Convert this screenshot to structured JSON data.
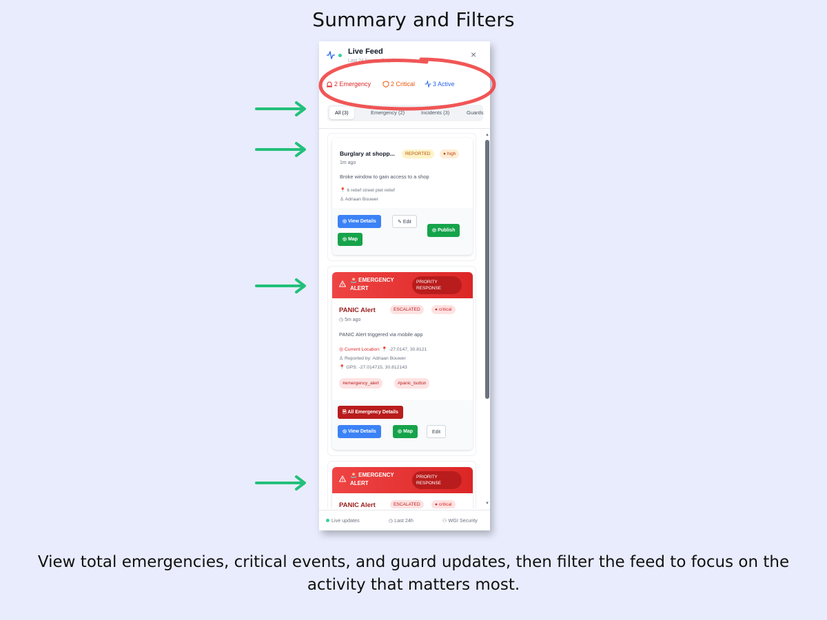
{
  "page": {
    "heading": "Summary and Filters",
    "caption": "View total emergencies, critical events, and guard updates, then filter the feed to focus on the activity that matters most."
  },
  "panel": {
    "title": "Live Feed",
    "subtitle": "Last 24 hours • 3 updates",
    "close_icon": "×",
    "stats": {
      "emergency": "2 Emergency",
      "critical": "2 Critical",
      "active": "3 Active"
    },
    "tabs": [
      {
        "label": "All (3)",
        "active": true
      },
      {
        "label": "Emergency (2)",
        "active": false
      },
      {
        "label": "Incidents (3)",
        "active": false
      },
      {
        "label": "Guards",
        "active": false
      }
    ],
    "incident": {
      "title": "Burglary at shopp...",
      "status": "REPORTED",
      "severity": "high",
      "time": "1m ago",
      "description": "Broke window to gain access to a shop",
      "address": "6 retief street piet retief",
      "reporter": "Adriaan Bouwer",
      "buttons": {
        "view": "View Details",
        "edit": "Edit",
        "publish": "Publish",
        "map": "Map"
      }
    },
    "alerts": [
      {
        "band_title": "🚨 EMERGENCY ALERT",
        "priority": "PRIORITY RESPONSE",
        "title": "PANIC Alert",
        "status": "ESCALATED",
        "severity": "critical",
        "time": "5m ago",
        "description": "PANIC Alert triggered via mobile app",
        "location_label": "Current Location:",
        "location_value": "-27.0147, 30.8121",
        "reported_by": "Reported by: Adriaan Bouwer",
        "gps": "GPS: -27.014715, 30.812143",
        "tags": [
          "#emergency_alert",
          "#panic_button"
        ],
        "buttons": {
          "all": "All Emergency Details",
          "view": "View Details",
          "map": "Map",
          "edit": "Edit"
        }
      },
      {
        "band_title": "🚨 EMERGENCY ALERT",
        "priority": "PRIORITY RESPONSE",
        "title": "PANIC Alert",
        "status": "ESCALATED",
        "severity": "critical"
      }
    ],
    "footer": {
      "live": "Live updates",
      "range": "Last 24h",
      "org": "WGI Security"
    }
  },
  "colors": {
    "accent_red": "#dc2626",
    "accent_orange": "#ea580c",
    "accent_blue": "#2563eb",
    "arrow_green": "#22c07a",
    "annotation_ring": "#ef4444"
  }
}
